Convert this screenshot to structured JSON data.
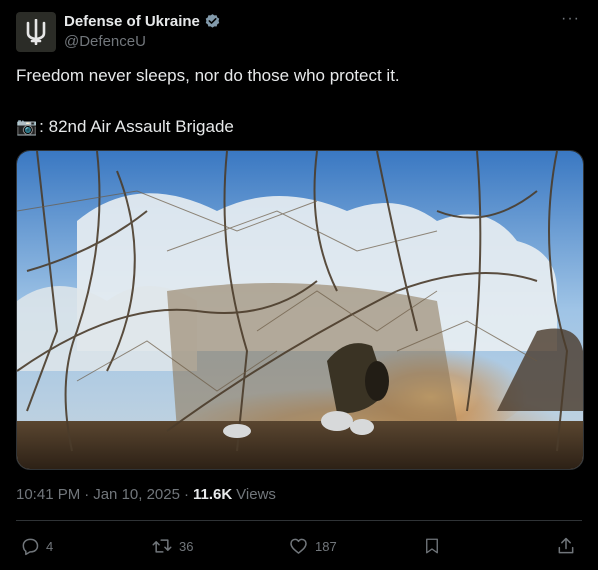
{
  "author": {
    "name": "Defense of Ukraine",
    "handle": "@DefenceU",
    "avatar_icon": "trident-icon",
    "verified_icon": "verified-badge-icon"
  },
  "menu_icon": "more-icon",
  "post": {
    "text": "Freedom never sleeps, nor do those who protect it.",
    "credit_emoji": "📷",
    "credit_text": ": 82nd Air Assault Brigade"
  },
  "meta": {
    "time": "10:41 PM",
    "sep1": "·",
    "date": "Jan 10, 2025",
    "sep2": "·",
    "views_count": "11.6K",
    "views_label": "Views"
  },
  "actions": {
    "replies": "4",
    "reposts": "36",
    "likes": "187"
  },
  "colors": {
    "background": "#000000",
    "text": "#e7e9ea",
    "secondary": "#71767b",
    "verified": "#829aab",
    "border": "#2f3336"
  }
}
